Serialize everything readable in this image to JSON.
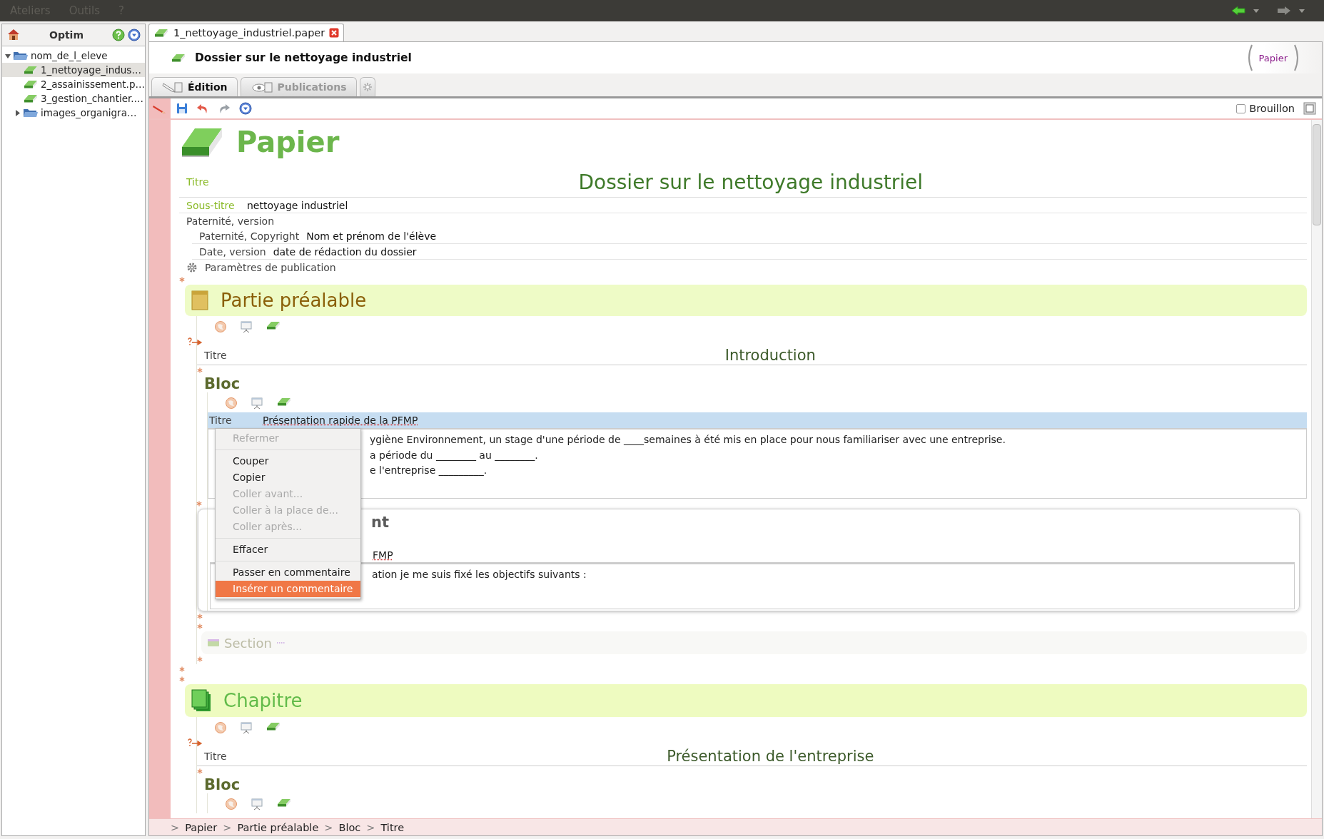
{
  "menu_bar": {
    "items": [
      "Ateliers",
      "Outils",
      "?"
    ]
  },
  "sidebar": {
    "title": "Optim",
    "tree": [
      {
        "label": "nom_de_l_eleve",
        "kind": "folder",
        "expanded": true,
        "selected": false,
        "children": [
          {
            "label": "1_nettoyage_indus…",
            "kind": "paper",
            "selected": true
          },
          {
            "label": "2_assainissement.p…",
            "kind": "paper",
            "selected": false
          },
          {
            "label": "3_gestion_chantier.…",
            "kind": "paper",
            "selected": false
          },
          {
            "label": "images_organigra…",
            "kind": "folder",
            "expanded": false,
            "selected": false
          }
        ]
      }
    ]
  },
  "document_tab": {
    "label": "1_nettoyage_industriel.paper"
  },
  "header": {
    "title": "Dossier sur le nettoyage industriel",
    "type_label": "Papier"
  },
  "view_tabs": [
    {
      "label": "Édition",
      "kind": "edit",
      "selected": true
    },
    {
      "label": "Publications",
      "kind": "publish",
      "selected": false
    }
  ],
  "toolbar": {
    "draft": {
      "label": "Brouillon",
      "checked": false
    }
  },
  "document": {
    "type_label": "Papier",
    "title_label": "Titre",
    "title": "Dossier sur le nettoyage industriel",
    "subtitle_label": "Sous-titre",
    "subtitle": "nettoyage industriel",
    "authorship_label": "Paternité, version",
    "fields": [
      {
        "label": "Paternité, Copyright",
        "value": "Nom et prénom de l'élève"
      },
      {
        "label": "Date, version",
        "value": "date de rédaction du dossier"
      }
    ],
    "publication_settings": "Paramètres de publication"
  },
  "part": {
    "title": "Partie préalable",
    "title_label": "Titre",
    "heading": "Introduction"
  },
  "bloc": {
    "label": "Bloc",
    "title_label": "Titre",
    "title": "Présentation rapide de la PFMP",
    "selected": true,
    "lines": [
      "ygiène Environnement, un stage d'une période de ____semaines à été mis en place pour nous familiariser avec une entreprise.",
      "a période du ________ au ________.",
      "e l'entreprise _________."
    ]
  },
  "second_bloc": {
    "title": "nt",
    "subtitle": "FMP",
    "lines": [
      "ation je me suis fixé les objectifs suivants :"
    ]
  },
  "section_placeholder": {
    "label": "Section"
  },
  "chapter": {
    "title": "Chapitre",
    "title_label": "Titre",
    "heading": "Présentation de l'entreprise",
    "bloc_label": "Bloc"
  },
  "context_menu": {
    "items": [
      {
        "kind": "item",
        "label": "Refermer",
        "disabled": true,
        "selected": false
      },
      {
        "kind": "separator"
      },
      {
        "kind": "item",
        "label": "Couper",
        "disabled": false,
        "selected": false
      },
      {
        "kind": "item",
        "label": "Copier",
        "disabled": false,
        "selected": false
      },
      {
        "kind": "item",
        "label": "Coller avant...",
        "disabled": true,
        "selected": false
      },
      {
        "kind": "item",
        "label": "Coller à la place de...",
        "disabled": true,
        "selected": false
      },
      {
        "kind": "item",
        "label": "Coller après...",
        "disabled": true,
        "selected": false
      },
      {
        "kind": "separator"
      },
      {
        "kind": "item",
        "label": "Effacer",
        "disabled": false,
        "selected": false
      },
      {
        "kind": "separator"
      },
      {
        "kind": "item",
        "label": "Passer en commentaire",
        "disabled": false,
        "selected": false
      },
      {
        "kind": "item",
        "label": "Insérer un commentaire",
        "disabled": false,
        "selected": true
      }
    ]
  },
  "breadcrumb": {
    "separator": ">",
    "items": [
      "Papier",
      "Partie préalable",
      "Bloc",
      "Titre"
    ]
  }
}
